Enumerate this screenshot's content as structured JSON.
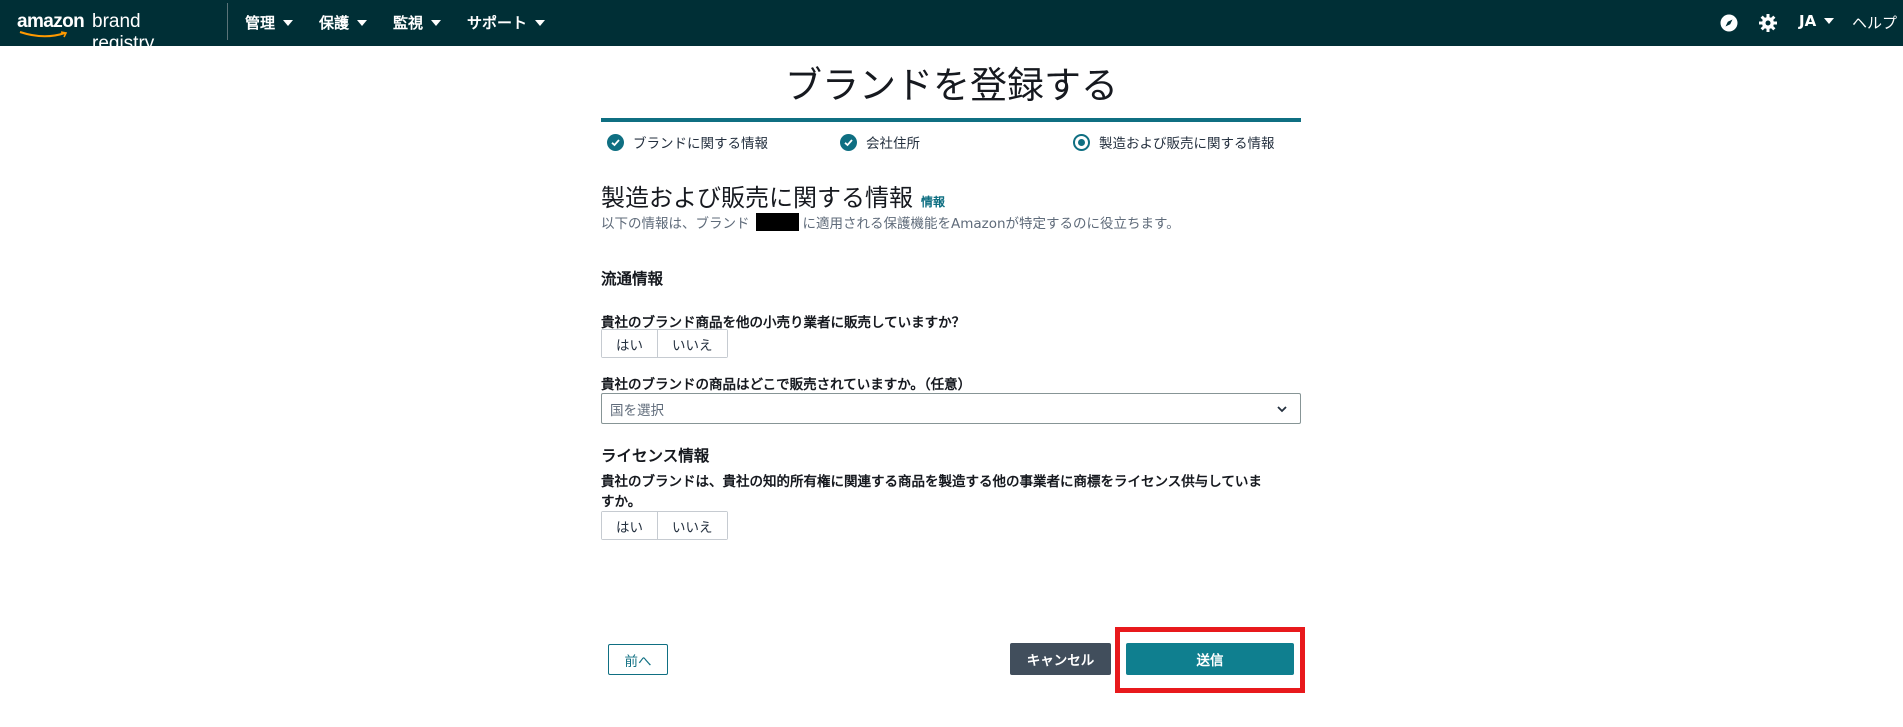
{
  "topnav": {
    "logo_amazon": "amazon",
    "logo_brand": "brand registry",
    "menus": [
      {
        "label": "管理"
      },
      {
        "label": "保護"
      },
      {
        "label": "監視"
      },
      {
        "label": "サポート"
      }
    ],
    "language": "JA",
    "help": "ヘルプ",
    "icons": [
      "compass-icon",
      "gear-icon"
    ]
  },
  "page": {
    "title": "ブランドを登録する"
  },
  "steps": [
    {
      "label": "ブランドに関する情報",
      "state": "completed"
    },
    {
      "label": "会社住所",
      "state": "completed"
    },
    {
      "label": "製造および販売に関する情報",
      "state": "current"
    }
  ],
  "section": {
    "title": "製造および販売に関する情報",
    "info_link": "情報",
    "intro_before": "以下の情報は、ブランド",
    "intro_after": "に適用される保護機能をAmazonが特定するのに役立ちます。"
  },
  "distribution": {
    "heading": "流通情報",
    "q1": "貴社のブランド商品を他の小売り業者に販売していますか？",
    "q1_yes": "はい",
    "q1_no": "いいえ",
    "q2": "貴社のブランドの商品はどこで販売されていますか。（任意）",
    "q2_placeholder": "国を選択"
  },
  "license": {
    "heading": "ライセンス情報",
    "q1_line1": "貴社のブランドは、貴社の知的所有権に関連する商品を製造する他の事業者に商標をライセンス供与していま",
    "q1_line2": "すか。",
    "q1_yes": "はい",
    "q1_no": "いいえ"
  },
  "actions": {
    "prev": "前へ",
    "cancel": "キャンセル",
    "submit": "送信"
  },
  "colors": {
    "nav_bg": "#002f36",
    "accent": "#0f6f82",
    "cancel_bg": "#414e5c",
    "highlight": "#e8191c"
  }
}
